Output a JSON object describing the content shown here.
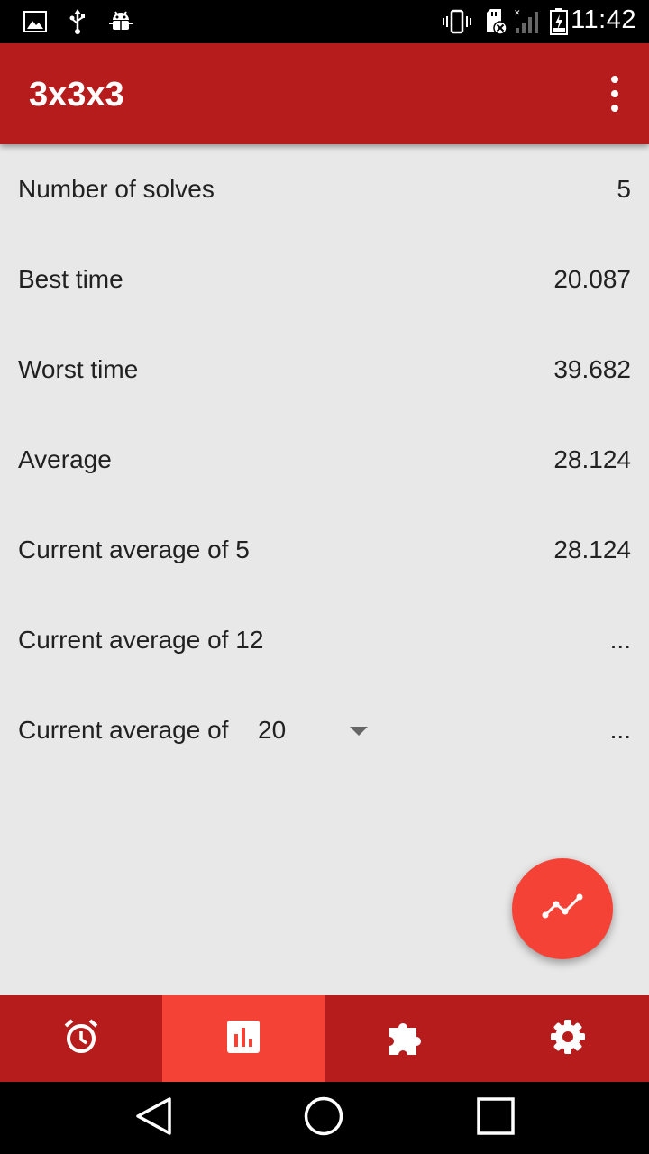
{
  "status_bar": {
    "time": "11:42",
    "icons": [
      "image-icon",
      "usb-icon",
      "android-debug-icon",
      "vibrate-icon",
      "sd-card-error-icon",
      "signal-icon",
      "battery-charging-icon"
    ]
  },
  "app_bar": {
    "title": "3x3x3",
    "menu_icon": "more-vert-icon"
  },
  "stats": {
    "rows": [
      {
        "label": "Number of solves",
        "value": "5"
      },
      {
        "label": "Best time",
        "value": "20.087"
      },
      {
        "label": "Worst time",
        "value": "39.682"
      },
      {
        "label": "Average",
        "value": "28.124"
      },
      {
        "label": "Current average of 5",
        "value": "28.124"
      },
      {
        "label": "Current average of 12",
        "value": "..."
      }
    ],
    "custom_average": {
      "label": "Current average of",
      "selected": "20",
      "value": "..."
    }
  },
  "fab": {
    "icon": "timeline-icon"
  },
  "bottom_nav": {
    "tabs": [
      {
        "icon": "alarm-icon",
        "active": false
      },
      {
        "icon": "stats-icon",
        "active": true
      },
      {
        "icon": "puzzle-icon",
        "active": false
      },
      {
        "icon": "settings-icon",
        "active": false
      }
    ]
  },
  "colors": {
    "primary": "#b71c1c",
    "accent": "#f44336",
    "background": "#e8e8e8"
  }
}
